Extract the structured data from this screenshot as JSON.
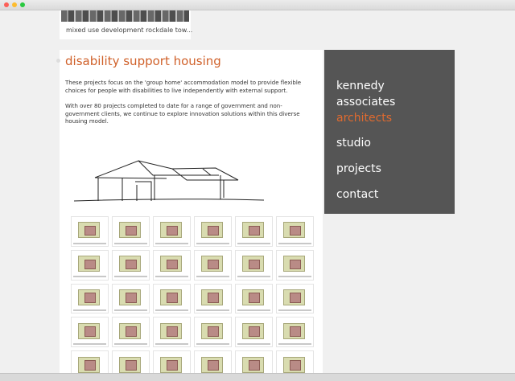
{
  "thumbnail": {
    "caption": "mixed use development rockdale tow..."
  },
  "article": {
    "heading": "disability support housing",
    "paragraph1": "These projects focus on the 'group home' accommodation model to provide flexible choices for people with disabilities to live independently with external support.",
    "paragraph2": "With over 80 projects completed to date for a range of government and non-government clients, we continue to explore innovation solutions within this diverse housing model."
  },
  "brand": {
    "line1": "kennedy",
    "line2": "associates",
    "line3": "architects"
  },
  "nav": {
    "studio": "studio",
    "projects": "projects",
    "contact": "contact"
  },
  "colors": {
    "accent": "#d0612a",
    "menu_bg": "#555555"
  }
}
